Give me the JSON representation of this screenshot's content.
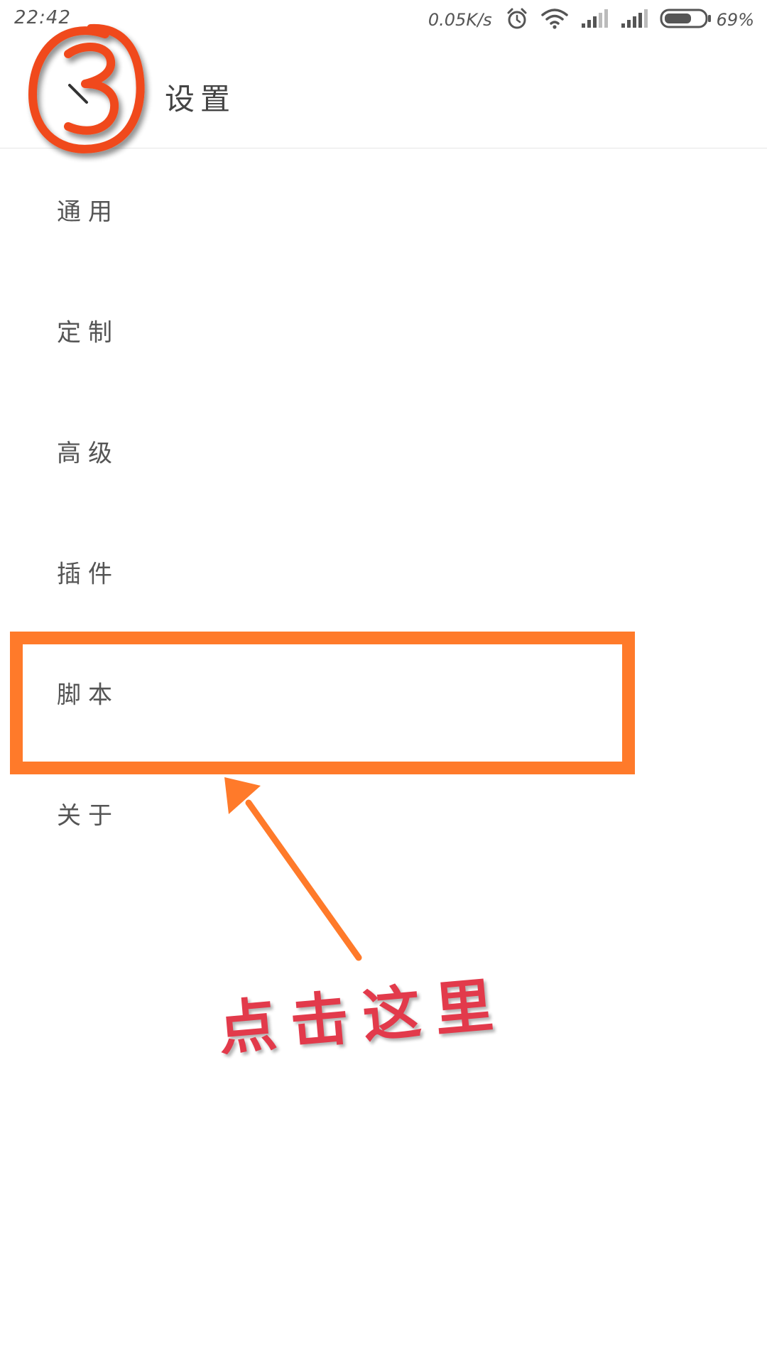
{
  "status_bar": {
    "time": "22:42",
    "network_speed": "0.05K/s",
    "battery_percent": "69%",
    "battery_level": 0.69,
    "icons": [
      "alarm-icon",
      "wifi-icon",
      "signal-icon",
      "signal-icon",
      "battery-icon"
    ]
  },
  "header": {
    "back_icon": "chevron-left-icon",
    "title": "设置"
  },
  "menu": {
    "items": [
      {
        "label": "通用"
      },
      {
        "label": "定制"
      },
      {
        "label": "高级"
      },
      {
        "label": "插件"
      },
      {
        "label": "脚本"
      },
      {
        "label": "关于"
      }
    ]
  },
  "annotations": {
    "step_number": "3",
    "hint_text": "点击这里",
    "highlight_color": "#ff7a2a",
    "arrow_color": "#ff7a2a",
    "hint_color": "#e23a4b"
  }
}
